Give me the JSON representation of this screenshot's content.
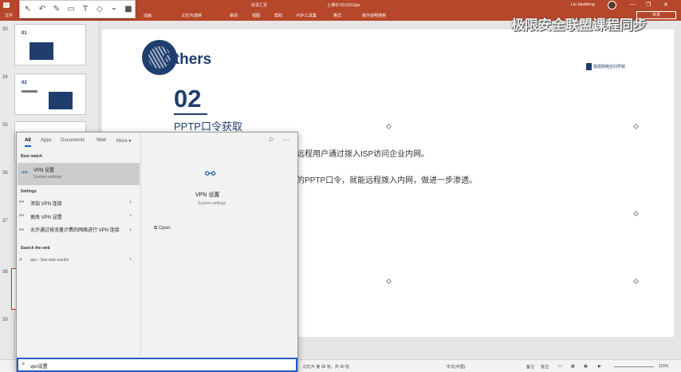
{
  "window": {
    "title": "收录汇报",
    "title_right": "上课中 03:02/10pe",
    "user": "Liu JiaoMeng",
    "controls": [
      "—",
      "❐",
      "✕"
    ]
  },
  "ribbon": {
    "tabs": [
      "文件",
      "开始",
      "插入",
      "设计",
      "切换",
      "动画",
      "幻灯片放映",
      "审阅",
      "视图",
      "帮助",
      "PDF工具集",
      "格式",
      "操作说明搜索"
    ],
    "share_label": "共享"
  },
  "watermark": "极限安全联盟课程同步",
  "thumbnails": [
    {
      "number": "33",
      "label": "01"
    },
    {
      "number": "34",
      "label": "02"
    },
    {
      "number": "35",
      "label": ""
    },
    {
      "number": "36",
      "label": ""
    },
    {
      "number": "37",
      "label": ""
    },
    {
      "number": "38",
      "label": ""
    },
    {
      "number": "39",
      "label": ""
    }
  ],
  "slide": {
    "section_title": "Others",
    "logo_text": "极限网络空间学院",
    "number": "02",
    "heading": "PPTP口令获取",
    "line1": "远程用户通过拨入ISP访问企业内网。",
    "line2": "的PPTP口令，就能远程拨入内网，做进一步渗透。"
  },
  "search_popup": {
    "tabs": [
      "All",
      "Apps",
      "Documents",
      "Web",
      "More ▾"
    ],
    "best_match_header": "Best match",
    "best_match": {
      "title": "VPN 设置",
      "subtitle": "System settings"
    },
    "settings_header": "Settings",
    "settings_items": [
      "添加 VPN 连接",
      "更改 VPN 设置",
      "允许通过按流量计费的网络进行 VPN 连接"
    ],
    "web_header": "Search the web",
    "web_item": "vpn - See web results",
    "preview": {
      "title": "VPN 设置",
      "subtitle": "System settings",
      "open_label": "Open"
    },
    "query": "vpn设置"
  },
  "status_bar": {
    "slide_info": "幻灯片 第 38 张，共 40 张",
    "language": "中文(中国)",
    "notes": "备注",
    "comments": "批注",
    "zoom": "115%"
  },
  "colors": {
    "titlebar": "#b7472a",
    "accent": "#1f3e6e",
    "search_border": "#1f5ec4"
  }
}
